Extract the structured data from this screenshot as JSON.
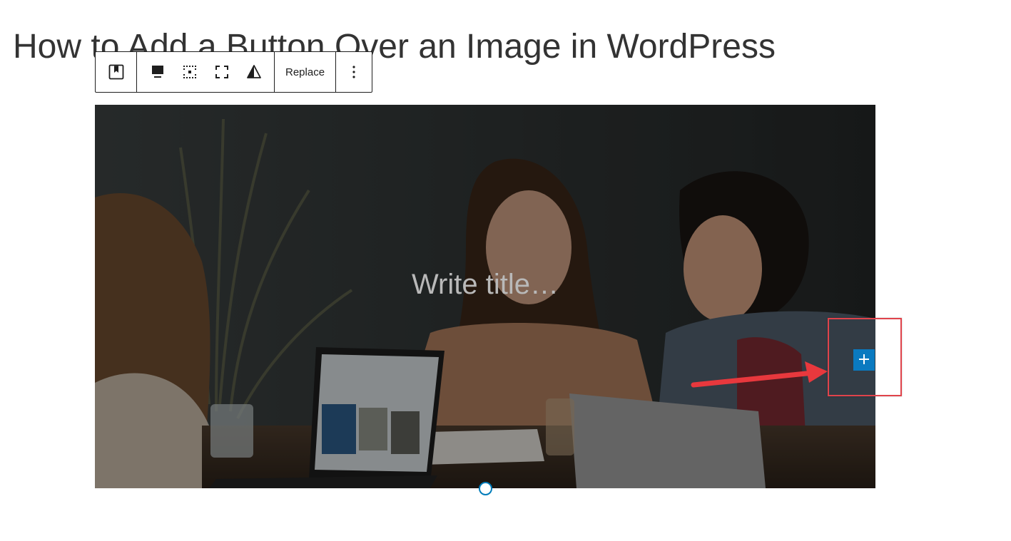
{
  "page": {
    "title": "How to Add a Button Over an Image in WordPress"
  },
  "toolbar": {
    "groups": [
      {
        "items": [
          {
            "icon": "cover-block-icon"
          }
        ]
      },
      {
        "items": [
          {
            "icon": "align-bottom-icon"
          },
          {
            "icon": "position-dots-icon"
          },
          {
            "icon": "fullscreen-icon"
          },
          {
            "icon": "duotone-filter-icon"
          }
        ]
      },
      {
        "items": [
          {
            "label": "Replace"
          }
        ]
      },
      {
        "items": [
          {
            "icon": "more-options-icon"
          }
        ]
      }
    ],
    "replace_label": "Replace"
  },
  "cover": {
    "placeholder": "Write title…",
    "overlay_color": "#000000"
  },
  "inserter": {
    "icon": "plus-icon",
    "color": "#0a7ac0"
  },
  "annotation": {
    "highlight_color": "#e0434b",
    "arrow_color": "#e8383d"
  }
}
